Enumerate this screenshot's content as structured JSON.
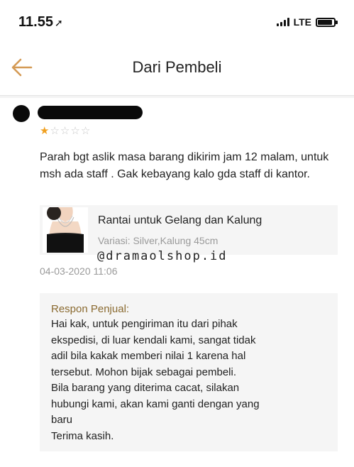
{
  "status_bar": {
    "time": "11.55",
    "network": "LTE"
  },
  "nav": {
    "title": "Dari Pembeli"
  },
  "review": {
    "rating": 1,
    "rating_max": 5,
    "text": "Parah bgt aslik masa barang dikirim jam 12 malam, untuk msh ada staff . Gak kebayang kalo gda staff di kantor.",
    "product_name": "Rantai untuk Gelang dan Kalung",
    "product_variant": "Variasi: Silver,Kalung 45cm",
    "date": "04-03-2020 11:06"
  },
  "watermark": "@dramaolshop.id",
  "seller_response": {
    "label": "Respon Penjual:",
    "lines": [
      "Hai kak, untuk pengiriman itu dari pihak",
      "ekspedisi, di luar kendali kami, sangat tidak",
      "adil bila kakak memberi nilai 1 karena hal",
      "tersebut. Mohon bijak sebagai pembeli.",
      "Bila barang yang diterima cacat, silakan",
      "hubungi kami, akan kami ganti dengan yang",
      "baru",
      "Terima kasih."
    ]
  },
  "colors": {
    "star_filled": "#f0a020",
    "back_arrow": "#d49a55",
    "response_label": "#8a6a30"
  },
  "icons": {
    "back": "arrow-left-icon",
    "star": "star-icon"
  }
}
